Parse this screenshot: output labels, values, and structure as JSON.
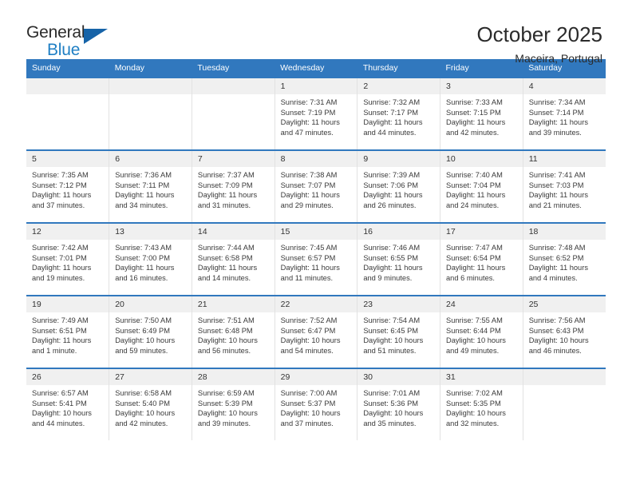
{
  "brand": {
    "line1": "General",
    "line2": "Blue",
    "triangle_color": "#1663a8"
  },
  "header": {
    "title": "October 2025",
    "subtitle": "Maceira, Portugal"
  },
  "theme": {
    "header_blue": "#3178be",
    "daynum_background": "#f0f0f0",
    "cell_border": "#e2e2e2",
    "text": "#3a3a3a"
  },
  "weekday_headers": [
    "Sunday",
    "Monday",
    "Tuesday",
    "Wednesday",
    "Thursday",
    "Friday",
    "Saturday"
  ],
  "weeks": [
    [
      {
        "day": "",
        "sunrise": "",
        "sunset": "",
        "daylight": ""
      },
      {
        "day": "",
        "sunrise": "",
        "sunset": "",
        "daylight": ""
      },
      {
        "day": "",
        "sunrise": "",
        "sunset": "",
        "daylight": ""
      },
      {
        "day": "1",
        "sunrise": "Sunrise: 7:31 AM",
        "sunset": "Sunset: 7:19 PM",
        "daylight": "Daylight: 11 hours and 47 minutes."
      },
      {
        "day": "2",
        "sunrise": "Sunrise: 7:32 AM",
        "sunset": "Sunset: 7:17 PM",
        "daylight": "Daylight: 11 hours and 44 minutes."
      },
      {
        "day": "3",
        "sunrise": "Sunrise: 7:33 AM",
        "sunset": "Sunset: 7:15 PM",
        "daylight": "Daylight: 11 hours and 42 minutes."
      },
      {
        "day": "4",
        "sunrise": "Sunrise: 7:34 AM",
        "sunset": "Sunset: 7:14 PM",
        "daylight": "Daylight: 11 hours and 39 minutes."
      }
    ],
    [
      {
        "day": "5",
        "sunrise": "Sunrise: 7:35 AM",
        "sunset": "Sunset: 7:12 PM",
        "daylight": "Daylight: 11 hours and 37 minutes."
      },
      {
        "day": "6",
        "sunrise": "Sunrise: 7:36 AM",
        "sunset": "Sunset: 7:11 PM",
        "daylight": "Daylight: 11 hours and 34 minutes."
      },
      {
        "day": "7",
        "sunrise": "Sunrise: 7:37 AM",
        "sunset": "Sunset: 7:09 PM",
        "daylight": "Daylight: 11 hours and 31 minutes."
      },
      {
        "day": "8",
        "sunrise": "Sunrise: 7:38 AM",
        "sunset": "Sunset: 7:07 PM",
        "daylight": "Daylight: 11 hours and 29 minutes."
      },
      {
        "day": "9",
        "sunrise": "Sunrise: 7:39 AM",
        "sunset": "Sunset: 7:06 PM",
        "daylight": "Daylight: 11 hours and 26 minutes."
      },
      {
        "day": "10",
        "sunrise": "Sunrise: 7:40 AM",
        "sunset": "Sunset: 7:04 PM",
        "daylight": "Daylight: 11 hours and 24 minutes."
      },
      {
        "day": "11",
        "sunrise": "Sunrise: 7:41 AM",
        "sunset": "Sunset: 7:03 PM",
        "daylight": "Daylight: 11 hours and 21 minutes."
      }
    ],
    [
      {
        "day": "12",
        "sunrise": "Sunrise: 7:42 AM",
        "sunset": "Sunset: 7:01 PM",
        "daylight": "Daylight: 11 hours and 19 minutes."
      },
      {
        "day": "13",
        "sunrise": "Sunrise: 7:43 AM",
        "sunset": "Sunset: 7:00 PM",
        "daylight": "Daylight: 11 hours and 16 minutes."
      },
      {
        "day": "14",
        "sunrise": "Sunrise: 7:44 AM",
        "sunset": "Sunset: 6:58 PM",
        "daylight": "Daylight: 11 hours and 14 minutes."
      },
      {
        "day": "15",
        "sunrise": "Sunrise: 7:45 AM",
        "sunset": "Sunset: 6:57 PM",
        "daylight": "Daylight: 11 hours and 11 minutes."
      },
      {
        "day": "16",
        "sunrise": "Sunrise: 7:46 AM",
        "sunset": "Sunset: 6:55 PM",
        "daylight": "Daylight: 11 hours and 9 minutes."
      },
      {
        "day": "17",
        "sunrise": "Sunrise: 7:47 AM",
        "sunset": "Sunset: 6:54 PM",
        "daylight": "Daylight: 11 hours and 6 minutes."
      },
      {
        "day": "18",
        "sunrise": "Sunrise: 7:48 AM",
        "sunset": "Sunset: 6:52 PM",
        "daylight": "Daylight: 11 hours and 4 minutes."
      }
    ],
    [
      {
        "day": "19",
        "sunrise": "Sunrise: 7:49 AM",
        "sunset": "Sunset: 6:51 PM",
        "daylight": "Daylight: 11 hours and 1 minute."
      },
      {
        "day": "20",
        "sunrise": "Sunrise: 7:50 AM",
        "sunset": "Sunset: 6:49 PM",
        "daylight": "Daylight: 10 hours and 59 minutes."
      },
      {
        "day": "21",
        "sunrise": "Sunrise: 7:51 AM",
        "sunset": "Sunset: 6:48 PM",
        "daylight": "Daylight: 10 hours and 56 minutes."
      },
      {
        "day": "22",
        "sunrise": "Sunrise: 7:52 AM",
        "sunset": "Sunset: 6:47 PM",
        "daylight": "Daylight: 10 hours and 54 minutes."
      },
      {
        "day": "23",
        "sunrise": "Sunrise: 7:54 AM",
        "sunset": "Sunset: 6:45 PM",
        "daylight": "Daylight: 10 hours and 51 minutes."
      },
      {
        "day": "24",
        "sunrise": "Sunrise: 7:55 AM",
        "sunset": "Sunset: 6:44 PM",
        "daylight": "Daylight: 10 hours and 49 minutes."
      },
      {
        "day": "25",
        "sunrise": "Sunrise: 7:56 AM",
        "sunset": "Sunset: 6:43 PM",
        "daylight": "Daylight: 10 hours and 46 minutes."
      }
    ],
    [
      {
        "day": "26",
        "sunrise": "Sunrise: 6:57 AM",
        "sunset": "Sunset: 5:41 PM",
        "daylight": "Daylight: 10 hours and 44 minutes."
      },
      {
        "day": "27",
        "sunrise": "Sunrise: 6:58 AM",
        "sunset": "Sunset: 5:40 PM",
        "daylight": "Daylight: 10 hours and 42 minutes."
      },
      {
        "day": "28",
        "sunrise": "Sunrise: 6:59 AM",
        "sunset": "Sunset: 5:39 PM",
        "daylight": "Daylight: 10 hours and 39 minutes."
      },
      {
        "day": "29",
        "sunrise": "Sunrise: 7:00 AM",
        "sunset": "Sunset: 5:37 PM",
        "daylight": "Daylight: 10 hours and 37 minutes."
      },
      {
        "day": "30",
        "sunrise": "Sunrise: 7:01 AM",
        "sunset": "Sunset: 5:36 PM",
        "daylight": "Daylight: 10 hours and 35 minutes."
      },
      {
        "day": "31",
        "sunrise": "Sunrise: 7:02 AM",
        "sunset": "Sunset: 5:35 PM",
        "daylight": "Daylight: 10 hours and 32 minutes."
      },
      {
        "day": "",
        "sunrise": "",
        "sunset": "",
        "daylight": ""
      }
    ]
  ]
}
